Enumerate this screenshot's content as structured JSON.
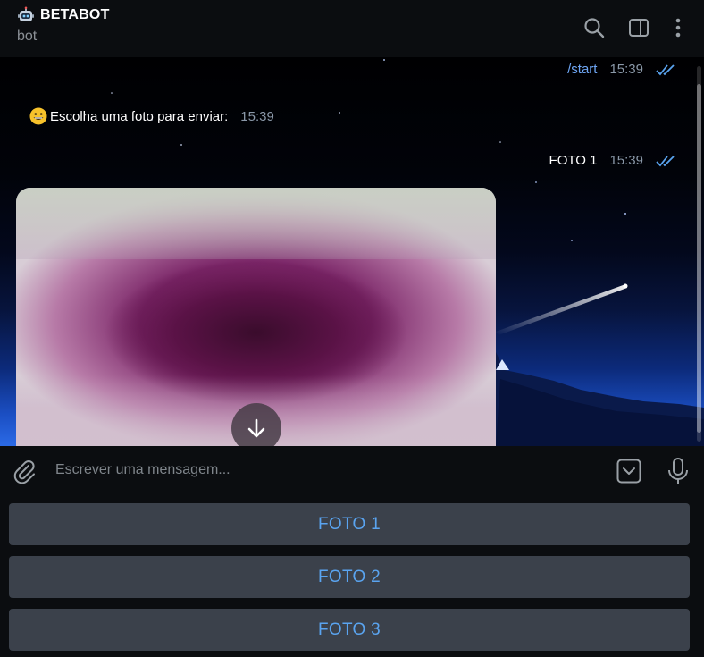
{
  "header": {
    "title": "BETABOT",
    "subtitle": "bot",
    "icons": [
      "search-icon",
      "sidebar-toggle-icon",
      "more-vertical-icon"
    ]
  },
  "messages": {
    "out_start": {
      "text": "/start",
      "time": "15:39",
      "status": "read"
    },
    "in_prompt": {
      "text": "Escolha uma foto para enviar:",
      "time": "15:39"
    },
    "out_foto": {
      "text": "FOTO 1",
      "time": "15:39",
      "status": "read"
    }
  },
  "composer": {
    "placeholder": "Escrever uma mensagem..."
  },
  "keyboard": {
    "buttons": [
      "FOTO 1",
      "FOTO 2",
      "FOTO 3"
    ]
  },
  "colors": {
    "accent": "#5aa4f0",
    "header_bg": "#0b0d10",
    "button_bg": "#3b414b"
  }
}
